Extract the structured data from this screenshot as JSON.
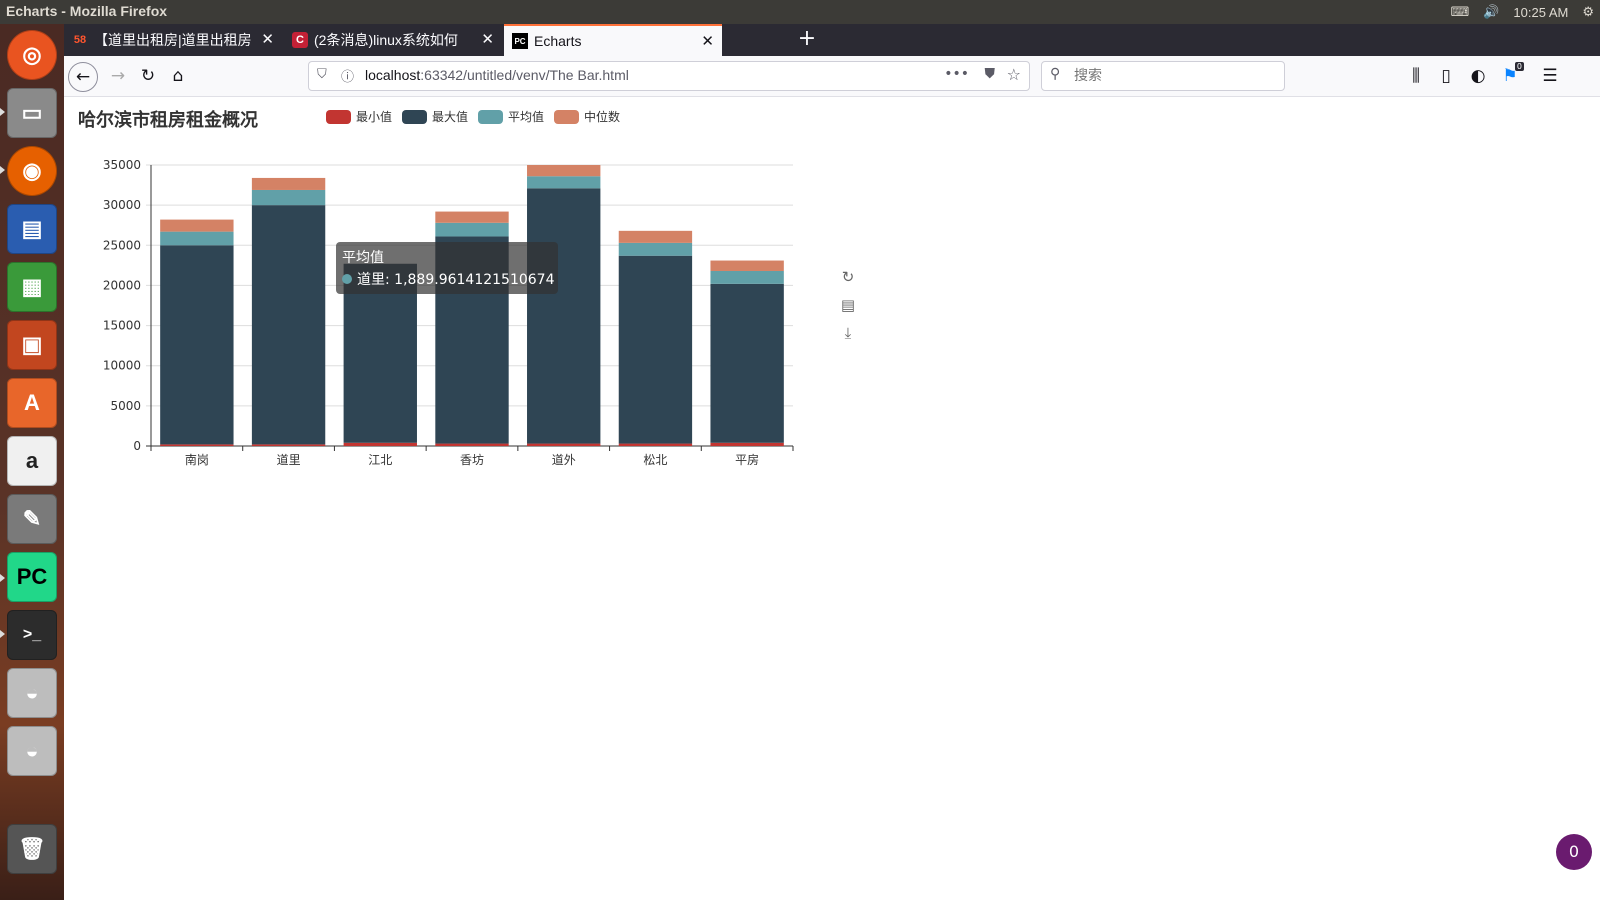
{
  "system": {
    "window_title": "Echarts - Mozilla Firefox",
    "clock": "10:25 AM"
  },
  "browser": {
    "tabs": [
      {
        "label": "【道里出租房|道里出租房",
        "favicon": "58-icon"
      },
      {
        "label": "(2条消息)linux系统如何",
        "favicon": "csdn-icon"
      },
      {
        "label": "Echarts",
        "favicon": "pycharm-icon"
      }
    ],
    "url_host": "localhost",
    "url_path": ":63342/untitled/venv/The Bar.html",
    "search_placeholder": "搜索",
    "notification_count": "0"
  },
  "page": {
    "badge_count": "0"
  },
  "colors": {
    "min": "#c23531",
    "max": "#2f4554",
    "avg": "#61a0a8",
    "median": "#d48265"
  },
  "chart_data": {
    "type": "bar",
    "stacked": true,
    "title": "哈尔滨市租房租金概况",
    "categories": [
      "南岗",
      "道里",
      "江北",
      "香坊",
      "道外",
      "松北",
      "平房"
    ],
    "ylim": [
      0,
      35000
    ],
    "yticks": [
      "0",
      "5000",
      "10000",
      "15000",
      "20000",
      "25000",
      "30000",
      "35000"
    ],
    "legend_position": "top",
    "grid": true,
    "series": [
      {
        "name": "最小值",
        "values": [
          200,
          200,
          400,
          300,
          300,
          300,
          400
        ]
      },
      {
        "name": "最大值",
        "values": [
          24800,
          29800,
          22300,
          25800,
          31800,
          23400,
          19800
        ]
      },
      {
        "name": "平均值",
        "values": [
          1700,
          1890,
          0,
          1700,
          1500,
          1600,
          1600
        ]
      },
      {
        "name": "中位数",
        "values": [
          1500,
          1500,
          0,
          1400,
          1400,
          1500,
          1300
        ]
      }
    ],
    "tooltip": {
      "title": "平均值",
      "line": "道里: 1,889.9614121510674"
    }
  }
}
